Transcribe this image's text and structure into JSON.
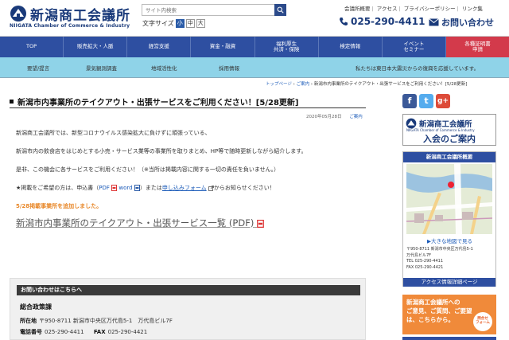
{
  "header": {
    "logo_title": "新潟商工会議所",
    "logo_sub": "NIIGATA Chamber of Commerce & Industry",
    "search_placeholder": "サイト内検索",
    "textsize_label": "文字サイズ",
    "textsize_options": [
      "小",
      "中",
      "大"
    ],
    "toplinks": [
      "会議所概要",
      "アクセス",
      "プライバシーポリシー",
      "リンク集"
    ],
    "phone": "025-290-4411",
    "contact": "お問い合わせ"
  },
  "nav": [
    {
      "label": "TOP"
    },
    {
      "label": "販売拡大・人脈"
    },
    {
      "label": "経営支援"
    },
    {
      "label": "資金・融資"
    },
    {
      "label": "福利厚生\n共済・保険"
    },
    {
      "label": "検定情報"
    },
    {
      "label": "イベント\nセミナー"
    },
    {
      "label": "各種証明書\n申請"
    }
  ],
  "subnav": {
    "items": [
      "要望/提言",
      "景気観測調査",
      "地域活性化",
      "採用情報"
    ],
    "notice": "私たちは東日本大震災からの復興を応援しています。"
  },
  "breadcrumb": {
    "top": "トップページ",
    "guide": "ご案内",
    "current": "新潟市内事業所のテイクアウト・出張サービスをご利用ください！[5/28更新]"
  },
  "main": {
    "title": "新潟市内事業所のテイクアウト・出張サービスをご利用ください！[5/28更新]",
    "date": "2020年05月28日",
    "date_link": "ご案内",
    "para1": "新潟商工会議所では、新型コロナウイルス感染拡大に負けずに頑張っている、",
    "para2": "新潟市内の飲食店をはじめとする小売・サービス業等の事業所を取りまとめ、HP等で随時更新しながら紹介します。",
    "para3": "是非、この機会に各サービスをご利用ください！（※当所は掲載内容に関する一切の責任を負いません。）",
    "para4_a": "★掲載をご希望の方は、申込書（",
    "para4_pdf": "PDF",
    "para4_word": "word",
    "para4_b": "）または",
    "para4_form": "申し込みフォーム",
    "para4_c": "からお知らせください！",
    "orange_note": "5/28掲載事業所を追加しました。",
    "big_link": "新潟市内事業所のテイクアウト・出張サービス一覧 (PDF)"
  },
  "contact_box": {
    "head": "お問い合わせはこちらへ",
    "dept": "総合政策課",
    "address_label": "所在地",
    "address": "〒950-8711 新潟市中央区万代島5-1　万代島ビル7F",
    "phone_label": "電話番号",
    "phone": "025-290-4411",
    "fax_label": "FAX",
    "fax": "025-290-4421"
  },
  "sidebar": {
    "join_title": "新潟商工会議所",
    "join_sub": "NIIGATA Chamber of Commerce & Industry",
    "join_main": "入会のご案内",
    "map_head": "新潟商工会議所概要",
    "map_more": "▶大きな地図で見る",
    "map_addr1": "〒950-8711 新潟市中央区万代島5-1",
    "map_addr2": "万代島ビル7F",
    "map_tel": "TEL 025-290-4411",
    "map_fax": "FAX 025-290-4421",
    "map_foot": "アクセス情報詳細ページ",
    "banner_line1": "新潟商工会議所への",
    "banner_line2": "ご意見、ご質問、ご要望",
    "banner_line3": "は、こちらから。",
    "banner_badge": "問合せ\nフォーム"
  },
  "colors": {
    "primary": "#2e4fa1",
    "accent_red": "#d33a4b",
    "subnav": "#8fd3e8",
    "orange": "#f08a3a"
  }
}
